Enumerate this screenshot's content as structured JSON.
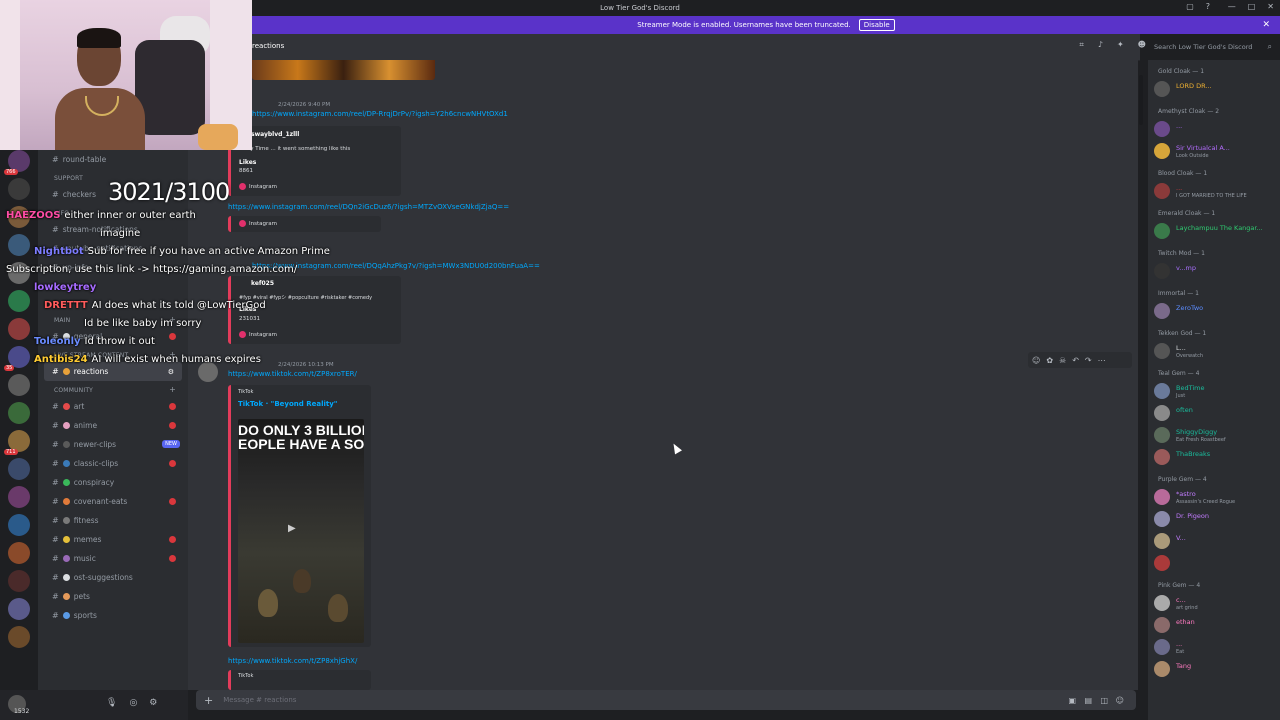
{
  "window": {
    "title": "Low Tier God's Discord"
  },
  "streamer_bar": {
    "text": "Streamer Mode is enabled. Usernames have been truncated.",
    "disable": "Disable"
  },
  "header": {
    "channel": "reactions",
    "search_placeholder": "Search Low Tier God's Discord"
  },
  "overlay": {
    "counter": "3021/3100",
    "chat": [
      {
        "user": "HAEZOOS",
        "text": "either inner or outer earth",
        "color": "#ff4da6"
      },
      {
        "user": "",
        "text": "imagine",
        "color": "#ffffff"
      },
      {
        "user": "Nightbot",
        "text": "Sub for free if you have an active Amazon Prime",
        "color": "#7d7dff"
      },
      {
        "user": "",
        "text": "Subscription, use this link -> https://gaming.amazon.com/",
        "color": "#ffffff"
      },
      {
        "user": "lowkeytrey",
        "text": "",
        "color": "#a66bff"
      },
      {
        "user": "DRETTT",
        "text": "AI does what its told @LowTierGod",
        "color": "#ff5c5c"
      },
      {
        "user": "",
        "text": "Id be like baby im sorry",
        "color": "#ffffff"
      },
      {
        "user": "Toleonly",
        "text": "Id throw it out",
        "color": "#6b8cff"
      },
      {
        "user": "Antibis24",
        "text": "AI will exist when humans expires",
        "color": "#ffcc33"
      }
    ]
  },
  "channels": {
    "top": [
      {
        "name": "round-table",
        "unread": false
      },
      {
        "name": "checkers",
        "unread": false
      },
      {
        "name": "stream-notifications",
        "unread": false
      },
      {
        "name": "youtube-notifications",
        "unread": false
      },
      {
        "name": "xp-info",
        "unread": false
      }
    ],
    "categories": {
      "support": "SUPPORT",
      "info": "INFO",
      "main": "MAIN",
      "live": "LIVE STREAM CONTENT",
      "community": "COMMUNITY"
    },
    "main": [
      {
        "name": "general",
        "unread": true
      }
    ],
    "live": [
      {
        "name": "reactions",
        "unread": false,
        "active": true
      }
    ],
    "community": [
      {
        "name": "art",
        "unread": true
      },
      {
        "name": "anime",
        "unread": true
      },
      {
        "name": "newer-clips",
        "unread": false,
        "new": "NEW"
      },
      {
        "name": "classic-clips",
        "unread": true
      },
      {
        "name": "conspiracy",
        "unread": false
      },
      {
        "name": "covenant-eats",
        "unread": true
      },
      {
        "name": "fitness",
        "unread": false
      },
      {
        "name": "memes",
        "unread": true
      },
      {
        "name": "music",
        "unread": true
      },
      {
        "name": "ost-suggestions",
        "unread": false
      },
      {
        "name": "pets",
        "unread": false
      },
      {
        "name": "sports",
        "unread": false
      }
    ]
  },
  "userbar": {
    "count": "1532"
  },
  "messages": {
    "m1": {
      "time": "2/24/2026 9:40 PM",
      "link": "https://www.instagram.com/reel/DP-RrqjDrPv/?igsh=Y2h6cncwNHVtOXd1"
    },
    "embed1": {
      "author": "swayblvd_1zlll",
      "desc": "Story Time ... it went something like this",
      "likes_label": "Likes",
      "likes": "8861",
      "provider": "Instagram"
    },
    "m2": {
      "link": "https://www.instagram.com/reel/DQn2iGcDuz6/?igsh=MTZvOXVseGNkdjZjaQ==",
      "provider": "Instagram"
    },
    "m3": {
      "link": "https://www.instagram.com/reel/DQqAhzPkg7v/?igsh=MWx3NDU0d200bnFuaA=="
    },
    "embed3": {
      "author": "kef025",
      "desc": "#fyp #viral #fypシ #popculture #risktaker #comedy",
      "likes_label": "Likes",
      "likes": "231031",
      "provider": "Instagram"
    },
    "m4": {
      "time": "2/24/2026 10:13 PM",
      "link": "https://www.tiktok.com/t/ZP8xroTER/"
    },
    "embed4": {
      "provider": "TikTok",
      "title": "TikTok · \"Beyond Reality\"",
      "thumb_text": "DO ONLY 3 BILLION\nEOPLE HAVE A SOUL"
    },
    "m5": {
      "link": "https://www.tiktok.com/t/ZP8xhjGhX/",
      "provider": "TikTok"
    }
  },
  "composer": {
    "placeholder": "Message # reactions"
  },
  "members": [
    {
      "group": "Gold Cloak — 1",
      "items": [
        {
          "name": "LORD DR...",
          "sub": "",
          "color": "#f0b232",
          "av": "#555"
        }
      ]
    },
    {
      "group": "Amethyst Cloak — 2",
      "items": [
        {
          "name": "...",
          "sub": "",
          "color": "#b46cff",
          "av": "#6a4a8a"
        },
        {
          "name": "Sir Virtualcal A...",
          "sub": "Look Outside",
          "color": "#b46cff",
          "av": "#d6a53a"
        }
      ]
    },
    {
      "group": "Blood Cloak — 1",
      "items": [
        {
          "name": "...",
          "sub": "I GOT MARRIED TO THE LIFE",
          "color": "#e23c3c",
          "av": "#8a3a3a"
        }
      ]
    },
    {
      "group": "Emerald Cloak — 1",
      "items": [
        {
          "name": "Laychampuu The Kangar...",
          "sub": "",
          "color": "#2ecc71",
          "av": "#3a7a4a"
        }
      ]
    },
    {
      "group": "Twitch Mod — 1",
      "items": [
        {
          "name": "v...mp",
          "sub": "",
          "color": "#a970ff",
          "av": "#333"
        }
      ]
    },
    {
      "group": "Immortal — 1",
      "items": [
        {
          "name": "ZeroTwo",
          "sub": "",
          "color": "#5b8cff",
          "av": "#7a6a8a"
        }
      ]
    },
    {
      "group": "Tekken God — 1",
      "items": [
        {
          "name": "L...",
          "sub": "Overwatch",
          "color": "#dbdee1",
          "av": "#555"
        }
      ]
    },
    {
      "group": "Teal Gem — 4",
      "items": [
        {
          "name": "BedTime",
          "sub": "Just",
          "color": "#1abc9c",
          "av": "#6a7a9a"
        },
        {
          "name": "often",
          "sub": "",
          "color": "#1abc9c",
          "av": "#8a8a8a"
        },
        {
          "name": "ShiggyDiggy",
          "sub": "Eat Fresh Roastbeef",
          "color": "#1abc9c",
          "av": "#5a6a5a"
        },
        {
          "name": "ThaBreaks",
          "sub": "",
          "color": "#1abc9c",
          "av": "#9a5a5a"
        }
      ]
    },
    {
      "group": "Purple Gem — 4",
      "items": [
        {
          "name": "*astro",
          "sub": "Assassin's Creed Rogue",
          "color": "#c27cff",
          "av": "#b86a9a"
        },
        {
          "name": "Dr. Pigeon",
          "sub": "",
          "color": "#c27cff",
          "av": "#8a8aaa"
        },
        {
          "name": "V...",
          "sub": "",
          "color": "#c27cff",
          "av": "#aa9a7a"
        },
        {
          "name": "",
          "sub": "",
          "color": "#c27cff",
          "av": "#aa3a3a"
        }
      ]
    },
    {
      "group": "Pink Gem — 4",
      "items": [
        {
          "name": "c...",
          "sub": "art grind",
          "color": "#ff7ac0",
          "av": "#aaa"
        },
        {
          "name": "ethan",
          "sub": "",
          "color": "#ff7ac0",
          "av": "#8a6a6a"
        },
        {
          "name": "...",
          "sub": "Eat",
          "color": "#ff7ac0",
          "av": "#6a6a8a"
        },
        {
          "name": "Tang",
          "sub": "",
          "color": "#ff7ac0",
          "av": "#aa8a6a"
        }
      ]
    }
  ]
}
